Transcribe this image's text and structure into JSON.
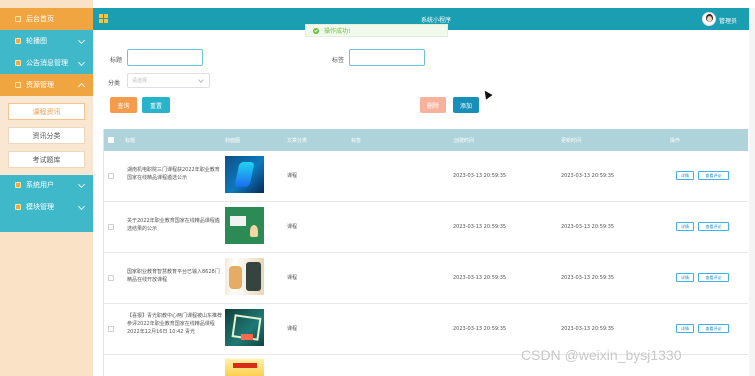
{
  "sidebar": {
    "items": [
      {
        "label": "后台首页",
        "icon": "home-icon"
      },
      {
        "label": "轮播图",
        "icon": "image-icon"
      },
      {
        "label": "公告消息管理",
        "icon": "notice-icon"
      },
      {
        "label": "资源管理",
        "icon": "resource-icon"
      },
      {
        "label": "系统用户",
        "icon": "user-icon"
      },
      {
        "label": "模块管理",
        "icon": "module-icon"
      }
    ],
    "subitems": [
      "课程资讯",
      "资讯分类",
      "考试题库"
    ]
  },
  "topbar": {
    "title": "系统小程序",
    "admin": "管理员",
    "grid_icon": "grid-icon",
    "avatar_icon": "avatar"
  },
  "toast": {
    "message": "操作成功!",
    "icon": "success-icon"
  },
  "search": {
    "title_label": "标题",
    "tag_label": "标签",
    "category_label": "分类",
    "category_placeholder": "请选择",
    "query_button": "查询",
    "reset_button": "重置",
    "delete_button": "删除",
    "add_button": "添加"
  },
  "table": {
    "headers": [
      "标题",
      "封面图",
      "文章分类",
      "标签",
      "创建时间",
      "更新时间",
      "操作"
    ],
    "rows": [
      {
        "title": "湖南机电职院三门课程获2022年职业教育国家在线精品课程遴选公示",
        "category": "课程",
        "created": "2023-03-13 20:59:35",
        "updated": "2023-03-13 20:59:35",
        "detail": "详情",
        "review": "查看评论"
      },
      {
        "title": "关于2022年职业教育国家在线精品课程遴选结果的公示",
        "category": "课程",
        "created": "2023-03-13 20:59:35",
        "updated": "2023-03-13 20:59:35",
        "detail": "详情",
        "review": "查看评论"
      },
      {
        "title": "国家职业教育智慧教育平台已输入8628门精品在线开放课程",
        "category": "课程",
        "created": "2023-03-13 20:59:35",
        "updated": "2023-03-13 20:59:35",
        "detail": "详情",
        "review": "查看评论"
      },
      {
        "title": "【喜报】青光职教中心两门课程被山东推荐参评2022年职业教育国家在线精品课程 2022年12月16日 10:42 青光",
        "category": "课程",
        "created": "2023-03-13 20:59:35",
        "updated": "2023-03-13 20:59:35",
        "detail": "详情",
        "review": "查看评论"
      }
    ]
  },
  "watermark": "CSDN @weixin_bysj1330",
  "colors": {
    "sidebar": "#3fb9ca",
    "sidebar_panel": "#fae2c6",
    "topbar": "#1a9eb2",
    "orange": "#f59c4c",
    "blue": "#188fb9"
  }
}
